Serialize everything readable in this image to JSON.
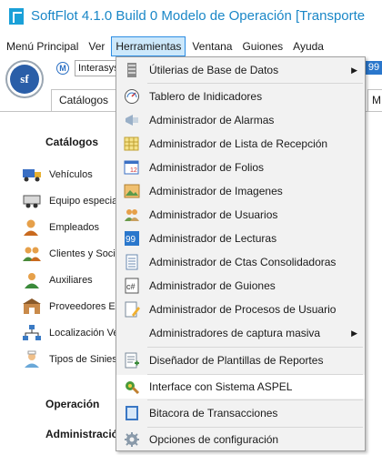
{
  "window": {
    "title": "SoftFlot 4.1.0 Build 0  Modelo de Operación [Transporte"
  },
  "menubar": {
    "items": [
      "Menú Principal",
      "Ver",
      "Herramientas",
      "Ventana",
      "Guiones",
      "Ayuda"
    ],
    "active_index": 2
  },
  "toolbar": {
    "company_value": "Interasys",
    "right_badge": "99",
    "m_label": "M",
    "logo_text": "sf"
  },
  "tabs": {
    "active": "Catálogos",
    "partial": "M"
  },
  "nav": {
    "sections": {
      "catalogos": "Catálogos",
      "operacion": "Operación",
      "administracion": "Administració"
    },
    "items": [
      {
        "label": "Vehículos",
        "icon": "truck-icon"
      },
      {
        "label": "Equipo especia",
        "icon": "trailer-icon"
      },
      {
        "label": "Empleados",
        "icon": "person-icon"
      },
      {
        "label": "Clientes y Socio",
        "icon": "people-icon"
      },
      {
        "label": "Auxiliares",
        "icon": "assistant-icon"
      },
      {
        "label": "Proveedores Ex",
        "icon": "warehouse-icon"
      },
      {
        "label": "Localización Ve",
        "icon": "network-icon"
      },
      {
        "label": "Tipos de Sinies",
        "icon": "nurse-icon"
      }
    ]
  },
  "dropdown": {
    "items": [
      {
        "label": "Útilerias de Base de Datos",
        "icon": "database-icon",
        "submenu": true
      },
      {
        "label": "Tablero de Inidicadores",
        "icon": "gauge-icon",
        "submenu": false
      },
      {
        "label": "Administrador de Alarmas",
        "icon": "alarm-icon",
        "submenu": false
      },
      {
        "label": "Administrador de Lista de Recepción",
        "icon": "list-calendar-icon",
        "submenu": false
      },
      {
        "label": "Administrador de Folios",
        "icon": "calendar-icon",
        "submenu": false
      },
      {
        "label": "Administrador de Imagenes",
        "icon": "image-icon",
        "submenu": false
      },
      {
        "label": "Administrador de Usuarios",
        "icon": "users-icon",
        "submenu": false
      },
      {
        "label": "Administrador de Lecturas",
        "icon": "readings-icon",
        "submenu": false
      },
      {
        "label": "Administrador de Ctas Consolidadoras",
        "icon": "accounts-icon",
        "submenu": false
      },
      {
        "label": "Administrador de Guiones",
        "icon": "script-icon",
        "submenu": false
      },
      {
        "label": "Administrador de Procesos de Usuario",
        "icon": "process-icon",
        "submenu": false
      },
      {
        "label": "Administradores de captura masiva",
        "icon": "",
        "submenu": true
      },
      {
        "label": "Diseñador de Plantillas de Reportes",
        "icon": "report-designer-icon",
        "submenu": false
      },
      {
        "label": "Interface con Sistema ASPEL",
        "icon": "aspel-icon",
        "submenu": false
      },
      {
        "label": "Bitacora de Transacciones",
        "icon": "log-icon",
        "submenu": false
      },
      {
        "label": "Opciones de configuración",
        "icon": "settings-icon",
        "submenu": false
      }
    ],
    "hover_index": 13
  },
  "colors": {
    "title": "#1a87c7",
    "menu_active_bg": "#cce8fb",
    "menu_active_border": "#2d8de3",
    "dropdown_bg": "#f2f2f2"
  }
}
